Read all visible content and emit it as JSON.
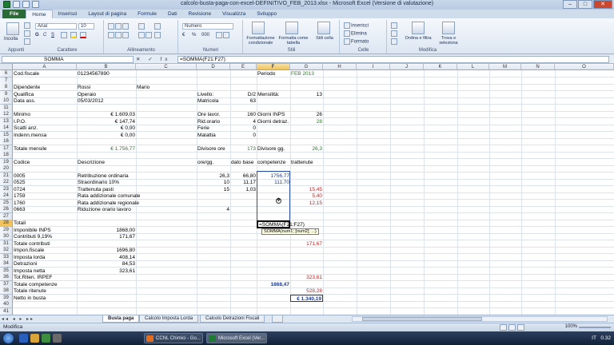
{
  "window": {
    "title": "calcolo-busta-paga-con-excel-DEFINITIVO_FEB_2013.xlsx  -  Microsoft Excel (Versione di valutazione)",
    "min": "–",
    "max": "□",
    "close": "✕"
  },
  "ribbon_tabs": [
    "File",
    "Home",
    "Inserisci",
    "Layout di pagina",
    "Formule",
    "Dati",
    "Revisione",
    "Visualizza",
    "Sviluppo"
  ],
  "ribbon": {
    "paste": "Incolla",
    "clipboard_label": "Appunti",
    "font_name": "Arial",
    "font_size": "10",
    "font_label": "Carattere",
    "align_label": "Allineamento",
    "number_format": "Numero",
    "number_label": "Numeri",
    "cond_format": "Formattazione condizionale",
    "format_table": "Formatta come tabella",
    "cell_styles": "Stili cella",
    "styles_label": "Stili",
    "insert": "Inserisci",
    "delete": "Elimina",
    "format": "Formato",
    "cells_label": "Celle",
    "sort": "Ordina e filtra",
    "find": "Trova e seleziona",
    "edit_label": "Modifica",
    "bold": "G",
    "italic": "C",
    "underline": "S",
    "currency": "€",
    "percent": "%",
    "thousands": "000"
  },
  "formula_bar": {
    "name_box": "SOMMA",
    "buttons": "✕ ✓ fx",
    "formula": "=SOMMA(F21:F27)"
  },
  "columns": [
    "A",
    "B",
    "C",
    "D",
    "E",
    "F",
    "G",
    "H",
    "I",
    "J",
    "K",
    "L",
    "M",
    "N",
    "O"
  ],
  "rows": [
    "6",
    "7",
    "8",
    "9",
    "10",
    "11",
    "12",
    "13",
    "14",
    "15",
    "16",
    "17",
    "18",
    "19",
    "20",
    "21",
    "22",
    "23",
    "24",
    "25",
    "26",
    "27",
    "28",
    "29",
    "30",
    "31",
    "32",
    "33",
    "34",
    "35",
    "36",
    "37",
    "38",
    "39",
    "40",
    "41"
  ],
  "cells": {
    "r6": {
      "a": "Cod.fiscale",
      "b": "01234567890",
      "f": "Periodo",
      "g": "FEB 2013"
    },
    "r8": {
      "a": "Dipendente",
      "b": "Rossi",
      "c": "Mario"
    },
    "r9": {
      "a": "Qualifica",
      "b": "Operaio",
      "d": "Livello:",
      "e": "D/2",
      "f": "Mensilità:",
      "g": "13"
    },
    "r10": {
      "a": "Data ass.",
      "b": "05/03/2012",
      "d": "Matricola",
      "e": "63"
    },
    "r12": {
      "a": "Minimo",
      "b": "€ 1.609,03",
      "d": "Ore lavor.",
      "e": "160",
      "f": "Giorni INPS",
      "g": "26"
    },
    "r13": {
      "a": "I.P.O.",
      "b": "€ 147,74",
      "d": "Rid.orario",
      "e": "4",
      "f": "Giorni detraz.",
      "g": "28"
    },
    "r14": {
      "a": "Scatti anz.",
      "b": "€ 0,00",
      "d": "Ferie",
      "e": "0"
    },
    "r15": {
      "a": "Indenn.mensa",
      "b": "€ 0,00",
      "d": "Malattia",
      "e": "0"
    },
    "r17": {
      "a": "Totale mensile",
      "b": "€ 1.756,77",
      "d": "Divisore ore",
      "e": "173",
      "f": "Divisore gg.",
      "g": "26,3"
    },
    "r19": {
      "a": "Codice",
      "b": "Descrizione",
      "d": "ore/gg.",
      "e": "dato base",
      "f": "competenze",
      "g": "trattenute"
    },
    "r21": {
      "a": "0005",
      "b": "Retribuzione ordinaria",
      "d": "26,3",
      "e": "66,80",
      "f": "1756,77"
    },
    "r22": {
      "a": "0525",
      "b": "Straordinario 10%",
      "d": "10",
      "e": "11,17",
      "f": "111,70"
    },
    "r23": {
      "a": "0724",
      "b": "Trattenuta pasti",
      "d": "15",
      "e": "1,03",
      "g": "15,45"
    },
    "r24": {
      "a": "1759",
      "b": "Rata addizionale comunale",
      "g": "5,40"
    },
    "r25": {
      "a": "1760",
      "b": "Rata addizionale regionale",
      "g": "12,15"
    },
    "r26": {
      "a": "0663",
      "b": "Riduzione orario lavoro",
      "d": "4"
    },
    "r28": {
      "a": "Totali",
      "f": "=SOMMA(F21:F27)"
    },
    "r29": {
      "a": "Imponibile INPS",
      "b": "1868,00"
    },
    "r30": {
      "a": "Contributi 9,19%",
      "b": "171,67"
    },
    "r31": {
      "a": "Totale contributi",
      "g": "171,67"
    },
    "r32": {
      "a": "Impon.fiscale",
      "b": "1696,80"
    },
    "r33": {
      "a": "Imposta lorda",
      "b": "408,14"
    },
    "r34": {
      "a": "Detrazioni",
      "b": "84,53"
    },
    "r35": {
      "a": "Imposta netta",
      "b": "323,61"
    },
    "r36": {
      "a": "Tot.Riten. IRPEF",
      "g": "323,61"
    },
    "r37": {
      "a": "Totale competenze",
      "f": "1868,47"
    },
    "r38": {
      "a": "Totale ritenute",
      "g": "528,28"
    },
    "r39": {
      "a": "Netto in busta",
      "g": "€ 1.340,19"
    }
  },
  "tooltip": "SOMMA(num1; [num2]; ...)",
  "cursor_glyph": "✥",
  "sheet_nav": "◂◂ ◂ ▸ ▸▸",
  "sheets": [
    "Busta paga",
    "Calcolo Imposta Lorda",
    "Calcolo Detrazioni Fiscali"
  ],
  "status": {
    "mode": "Modifica",
    "zoom": "100%"
  },
  "taskbar": {
    "items": [
      "CCNL Chimici - Go...",
      "Microsoft Excel (Ver..."
    ],
    "lang": "IT",
    "time": "0.32"
  }
}
